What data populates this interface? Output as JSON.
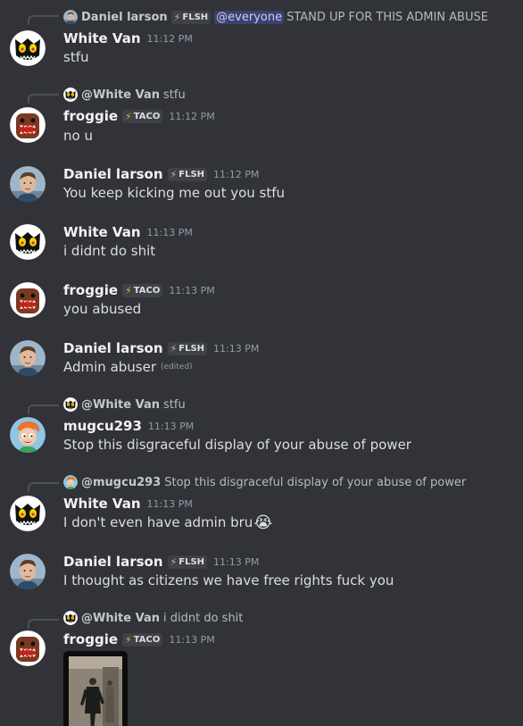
{
  "messages": [
    {
      "reply": {
        "name": "Daniel larson",
        "tag": "FLSH",
        "mention": "@everyone",
        "text": "STAND UP FOR THIS ADMIN ABUSE"
      },
      "author": "White Van",
      "time": "11:12 PM",
      "text": "stfu"
    },
    {
      "reply": {
        "name": "@White Van",
        "text": "stfu"
      },
      "author": "froggie",
      "tag": "TACO",
      "time": "11:12 PM",
      "text": "no u"
    },
    {
      "author": "Daniel larson",
      "tag": "FLSH",
      "time": "11:12 PM",
      "text": "You keep kicking me out you stfu"
    },
    {
      "author": "White Van",
      "time": "11:13 PM",
      "text": "i didnt do shit"
    },
    {
      "author": "froggie",
      "tag": "TACO",
      "time": "11:13 PM",
      "text": "you abused"
    },
    {
      "author": "Daniel larson",
      "tag": "FLSH",
      "time": "11:13 PM",
      "text": "Admin abuser",
      "edited": "(edited)"
    },
    {
      "reply": {
        "name": "@White Van",
        "text": "stfu"
      },
      "author": "mugcu293",
      "time": "11:13 PM",
      "text": "Stop this disgraceful display of your abuse of power"
    },
    {
      "reply": {
        "name": "@mugcu293",
        "text": "Stop this disgraceful display of your abuse of power"
      },
      "author": "White Van",
      "time": "11:13 PM",
      "text": "I don't even have admin bru",
      "emoji": "😭"
    },
    {
      "author": "Daniel larson",
      "tag": "FLSH",
      "time": "11:13 PM",
      "text": "I thought as citizens we have free rights fuck you"
    },
    {
      "reply": {
        "name": "@White Van",
        "text": "i didnt do shit"
      },
      "author": "froggie",
      "tag": "TACO",
      "time": "11:13 PM"
    }
  ],
  "colors": {
    "background": "#313338",
    "username": "#f2f3f5",
    "message_text": "#dbdee1",
    "timestamp": "#949ba4",
    "mention_bg": "#5865f24d",
    "tag_bg": "#3f4147",
    "taco_bolt": "#f0b232"
  },
  "icons": {
    "white_van_avatar": "black-creature-avatar-icon",
    "froggie_avatar": "domo-avatar-icon",
    "daniel_avatar": "person-photo-avatar-icon",
    "mugcu_avatar": "cartoon-boy-avatar-icon",
    "tag_bolt": "lightning-bolt-icon"
  }
}
